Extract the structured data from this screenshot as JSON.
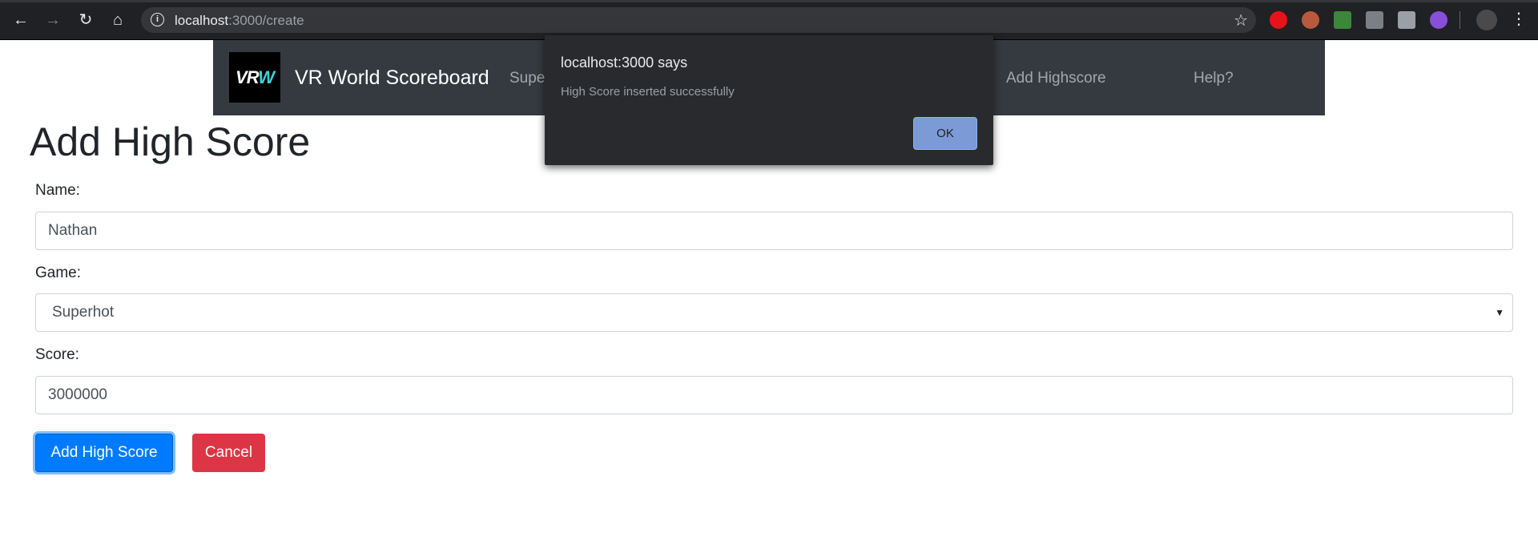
{
  "browser": {
    "url_host": "localhost",
    "url_path": ":3000/create"
  },
  "navbar": {
    "brand": "VR World Scoreboard",
    "logo_text": "VR",
    "logo_accent": "W",
    "links": [
      "Supe",
      "Add Highscore",
      "Help?"
    ]
  },
  "page": {
    "title": "Add High Score"
  },
  "form": {
    "name_label": "Name:",
    "name_value": "Nathan",
    "game_label": "Game:",
    "game_value": "Superhot",
    "score_label": "Score:",
    "score_value": "3000000",
    "submit_label": "Add High Score",
    "cancel_label": "Cancel"
  },
  "dialog": {
    "title": "localhost:3000 says",
    "message": "High Score inserted successfully",
    "ok_label": "OK"
  },
  "colors": {
    "primary": "#007bff",
    "danger": "#dc3545",
    "navbar": "#343a40",
    "chrome": "#202124"
  },
  "icons": [
    "back-icon",
    "forward-icon",
    "reload-icon",
    "home-icon",
    "site-info-icon",
    "bookmark-star-icon",
    "kebab-menu-icon"
  ]
}
